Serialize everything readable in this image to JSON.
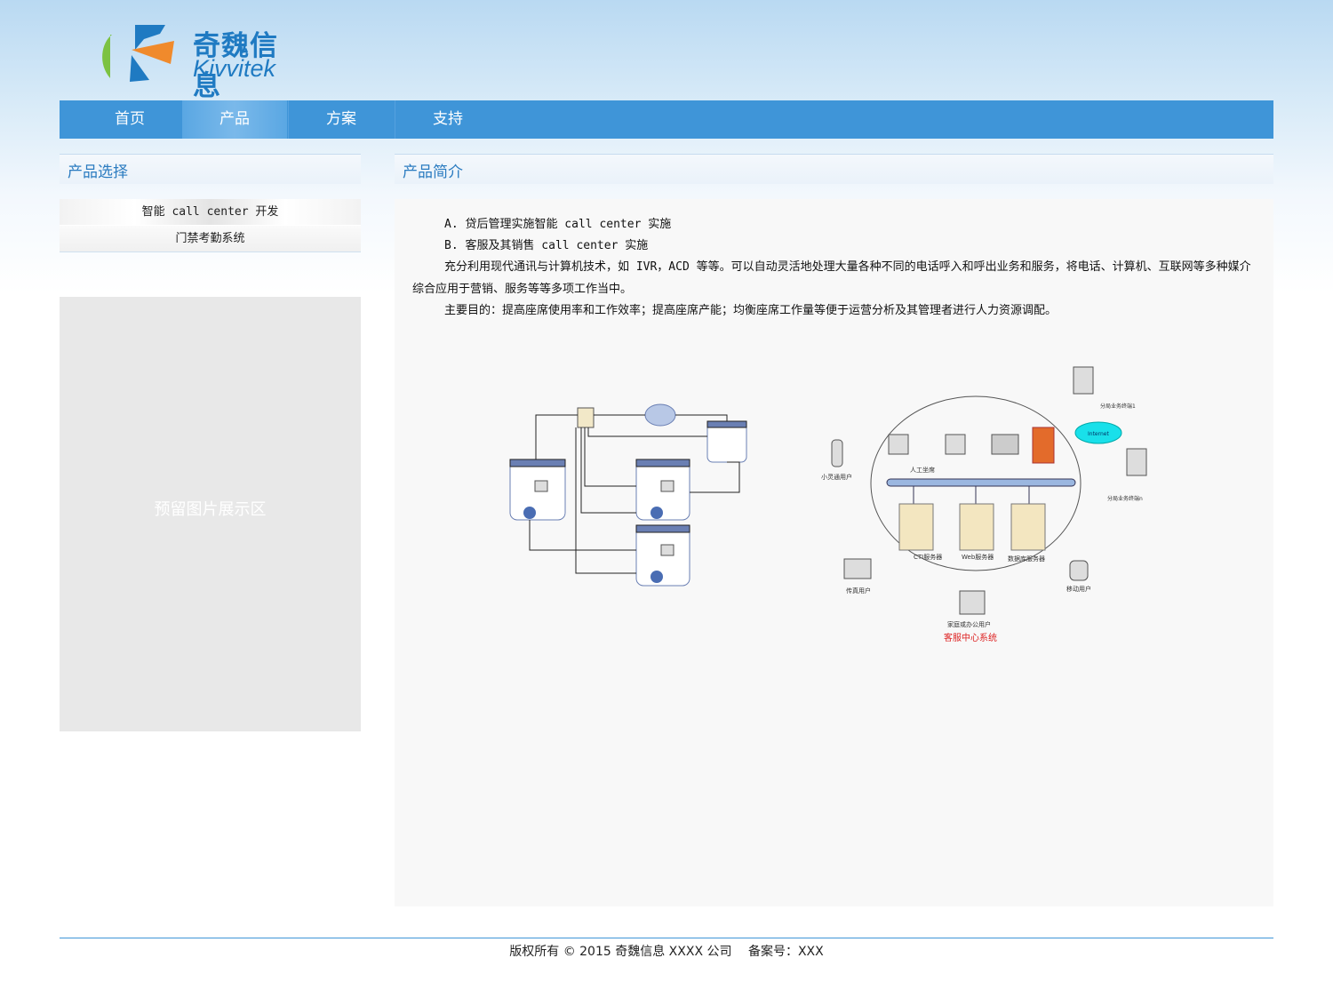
{
  "brand": {
    "name_cn": "奇魏信息",
    "name_en": "Kivvitek",
    "colors": {
      "blue": "#1f7ac2",
      "green": "#7cc242",
      "orange": "#f08a2c"
    }
  },
  "nav": {
    "items": [
      {
        "label": "首页"
      },
      {
        "label": "产品"
      },
      {
        "label": "方案"
      },
      {
        "label": "支持"
      }
    ],
    "active": "产品",
    "color": "#3f95d8"
  },
  "sidebar": {
    "title": "产品选择",
    "items": [
      {
        "label": "智能 call center 开发"
      },
      {
        "label": "门禁考勤系统"
      }
    ],
    "reserve_text": "预留图片展示区"
  },
  "main": {
    "title": "产品简介",
    "paragraphs": [
      "A. 贷后管理实施智能 call center 实施",
      "B. 客服及其销售 call center 实施",
      "充分利用现代通讯与计算机技术，如 IVR，ACD 等等。可以自动灵活地处理大量各种不同的电话呼入和呼出业务和服务，将电话、计算机、互联网等多种媒介综合应用于营销、服务等等多项工作当中。",
      "主要目的：提高座席使用率和工作效率；提高座席产能；均衡座席工作量等便于运营分析及其管理者进行人力资源调配。"
    ],
    "diagram_labels": {
      "mobile_small": "小灵通用户",
      "agent": "人工坐席",
      "terminal_1": "分局业务终端1",
      "terminal_n": "分局业务终端n",
      "internet": "Internet",
      "cti": "CTI服务器",
      "web": "Web服务器",
      "db": "数据库服务器",
      "fax": "传真用户",
      "mobile": "移动用户",
      "home": "家庭或办公用户",
      "caption": "客服中心系统"
    }
  },
  "footer": {
    "copyright": "版权所有 © 2015 奇魏信息 XXXX 公司",
    "icp": "备案号：XXX"
  }
}
